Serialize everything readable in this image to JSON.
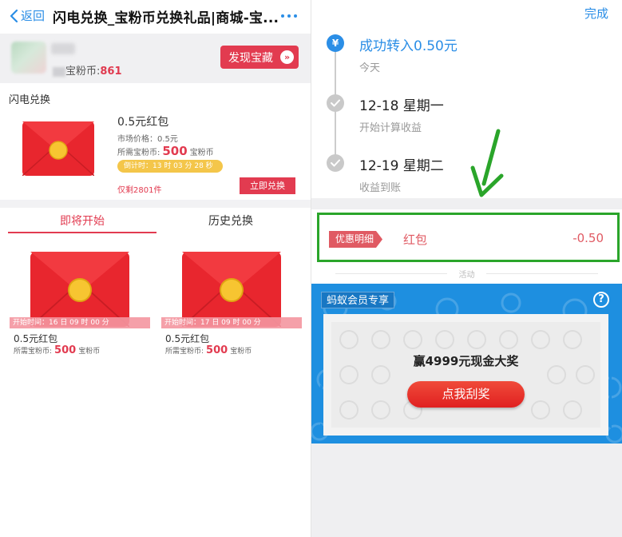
{
  "left": {
    "nav": {
      "back_label": "返回",
      "title": "闪电兑换_宝粉币兑换礼品|商城-宝..."
    },
    "user": {
      "coins_label": "宝粉币:",
      "coins_value": "861",
      "discover_label": "发现宝藏",
      "discover_arrows": "»"
    },
    "flash": {
      "section_title": "闪电兑换",
      "item_title": "0.5元红包",
      "market_price": "市场价格：0.5元",
      "need_prefix": "所需宝粉币:",
      "need_value": "500",
      "need_unit": "宝粉币",
      "countdown": "倒计时：13 时 03 分 28 秒",
      "remaining": "仅剩2801件",
      "redeem_label": "立即兑换"
    },
    "tabs": {
      "upcoming": "即将开始",
      "history": "历史兑换"
    },
    "cards": [
      {
        "start_time": "开始时间：16 日 09 时 00 分",
        "title": "0.5元红包",
        "need_prefix": "所需宝粉币:",
        "need_value": "500",
        "need_unit": "宝粉币"
      },
      {
        "start_time": "开始时间：17 日 09 时 00 分",
        "title": "0.5元红包",
        "need_prefix": "所需宝粉币:",
        "need_value": "500",
        "need_unit": "宝粉币"
      }
    ]
  },
  "right": {
    "done_label": "完成",
    "timeline": [
      {
        "title": "成功转入0.50元",
        "sub": "今天",
        "icon": "yen-icon"
      },
      {
        "title": "12-18 星期一",
        "sub": "开始计算收益",
        "icon": "check-icon"
      },
      {
        "title": "12-19 星期二",
        "sub": "收益到账",
        "icon": "check-icon"
      }
    ],
    "promo": {
      "tag": "优惠明细",
      "name": "红包",
      "amount": "-0.50"
    },
    "activity_label": "活动",
    "member_card": {
      "tag": "蚂蚁会员专享",
      "help": "?",
      "prize": "赢4999元现金大奖",
      "scratch_label": "点我刮奖"
    }
  },
  "colors": {
    "accent_red": "#e23b50",
    "link_blue": "#2b8ee6",
    "highlight_green": "#2aa52a",
    "member_blue": "#1e8fe0"
  }
}
